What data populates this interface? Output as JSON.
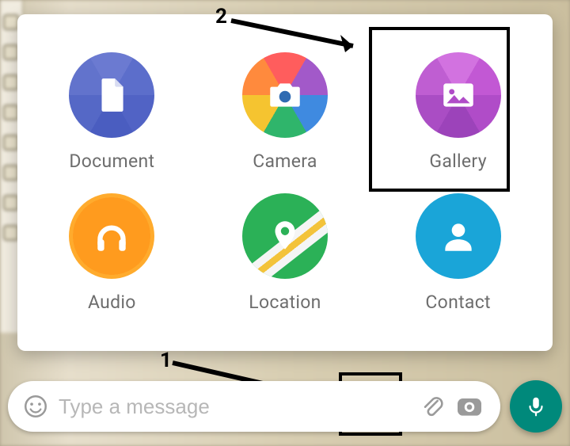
{
  "annotations": {
    "num1": "1",
    "num2": "2"
  },
  "attach_panel": {
    "document": {
      "label": "Document"
    },
    "camera": {
      "label": "Camera"
    },
    "gallery": {
      "label": "Gallery"
    },
    "audio": {
      "label": "Audio"
    },
    "location": {
      "label": "Location"
    },
    "contact": {
      "label": "Contact"
    }
  },
  "input": {
    "placeholder": "Type a message",
    "value": ""
  }
}
